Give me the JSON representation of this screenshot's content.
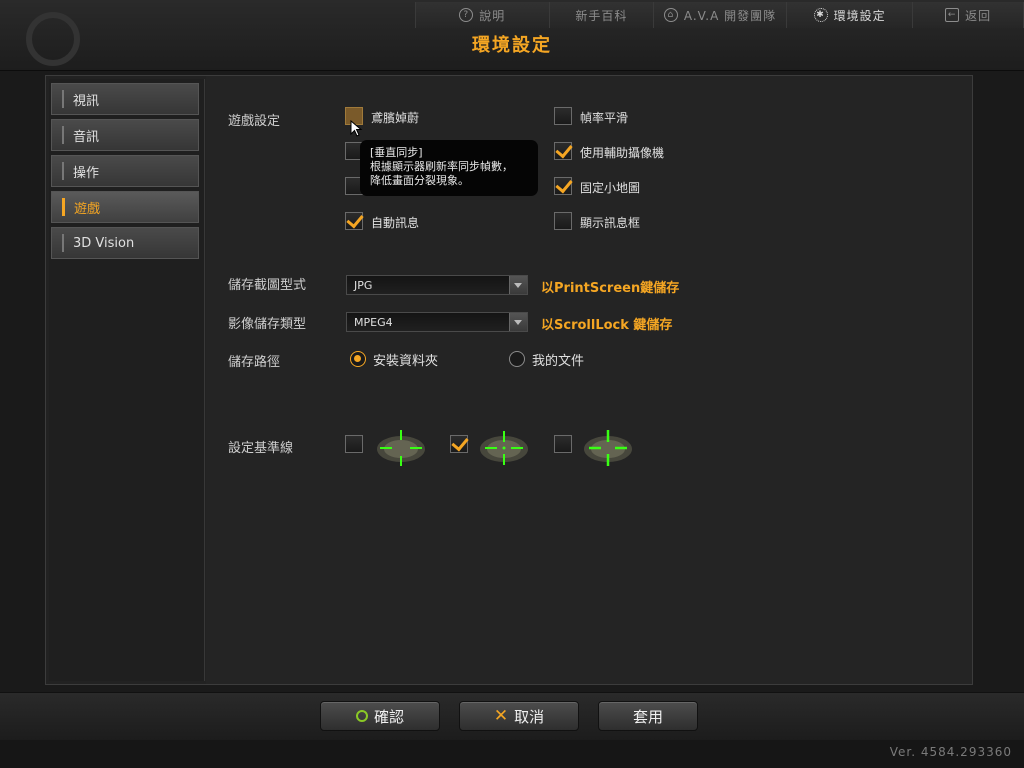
{
  "top_nav": [
    {
      "label": "說明",
      "icon": "question-icon"
    },
    {
      "label": "新手百科",
      "icon": ""
    },
    {
      "label": "A.V.A 開發團隊",
      "icon": "home-icon"
    },
    {
      "label": "環境設定",
      "icon": "gear-icon"
    },
    {
      "label": "返回",
      "icon": "back-icon"
    }
  ],
  "page_title": "環境設定",
  "sidebar": {
    "items": [
      {
        "label": "視訊"
      },
      {
        "label": "音訊"
      },
      {
        "label": "操作"
      },
      {
        "label": "遊戲"
      },
      {
        "label": "3D Vision"
      }
    ],
    "selected": "遊戲"
  },
  "game_settings": {
    "section_label": "遊戲設定",
    "left_options": [
      {
        "label": "鳶臏婥蔚",
        "checked": false
      },
      {
        "label": "",
        "checked": false
      },
      {
        "label": "",
        "checked": false
      },
      {
        "label": "自動訊息",
        "checked": true
      }
    ],
    "right_options": [
      {
        "label": "幀率平滑",
        "checked": false
      },
      {
        "label": "使用輔助攝像機",
        "checked": true
      },
      {
        "label": "固定小地圖",
        "checked": true
      },
      {
        "label": "顯示訊息框",
        "checked": false
      }
    ]
  },
  "tooltip": {
    "title": "[垂直同步]",
    "line1": "根據顯示器刷新率同步幀數，",
    "line2": "降低畫面分裂現象。"
  },
  "screenshot_format": {
    "label": "儲存截圖型式",
    "value": "JPG",
    "hint": "以PrintScreen鍵儲存"
  },
  "video_format": {
    "label": "影像儲存類型",
    "value": "MPEG4",
    "hint": "以ScrollLock 鍵儲存"
  },
  "save_path": {
    "label": "儲存路徑",
    "options": [
      "安裝資料夾",
      "我的文件"
    ],
    "selected": "安裝資料夾"
  },
  "crosshair": {
    "label": "設定基準線",
    "options": [
      {
        "style": "crosshair-1",
        "checked": false
      },
      {
        "style": "crosshair-2",
        "checked": true
      },
      {
        "style": "crosshair-3",
        "checked": false
      }
    ]
  },
  "buttons": {
    "ok": "確認",
    "cancel": "取消",
    "apply": "套用"
  },
  "version": "Ver. 4584.293360",
  "colors": {
    "accent": "#f5a623",
    "crosshair": "#39ff14"
  }
}
